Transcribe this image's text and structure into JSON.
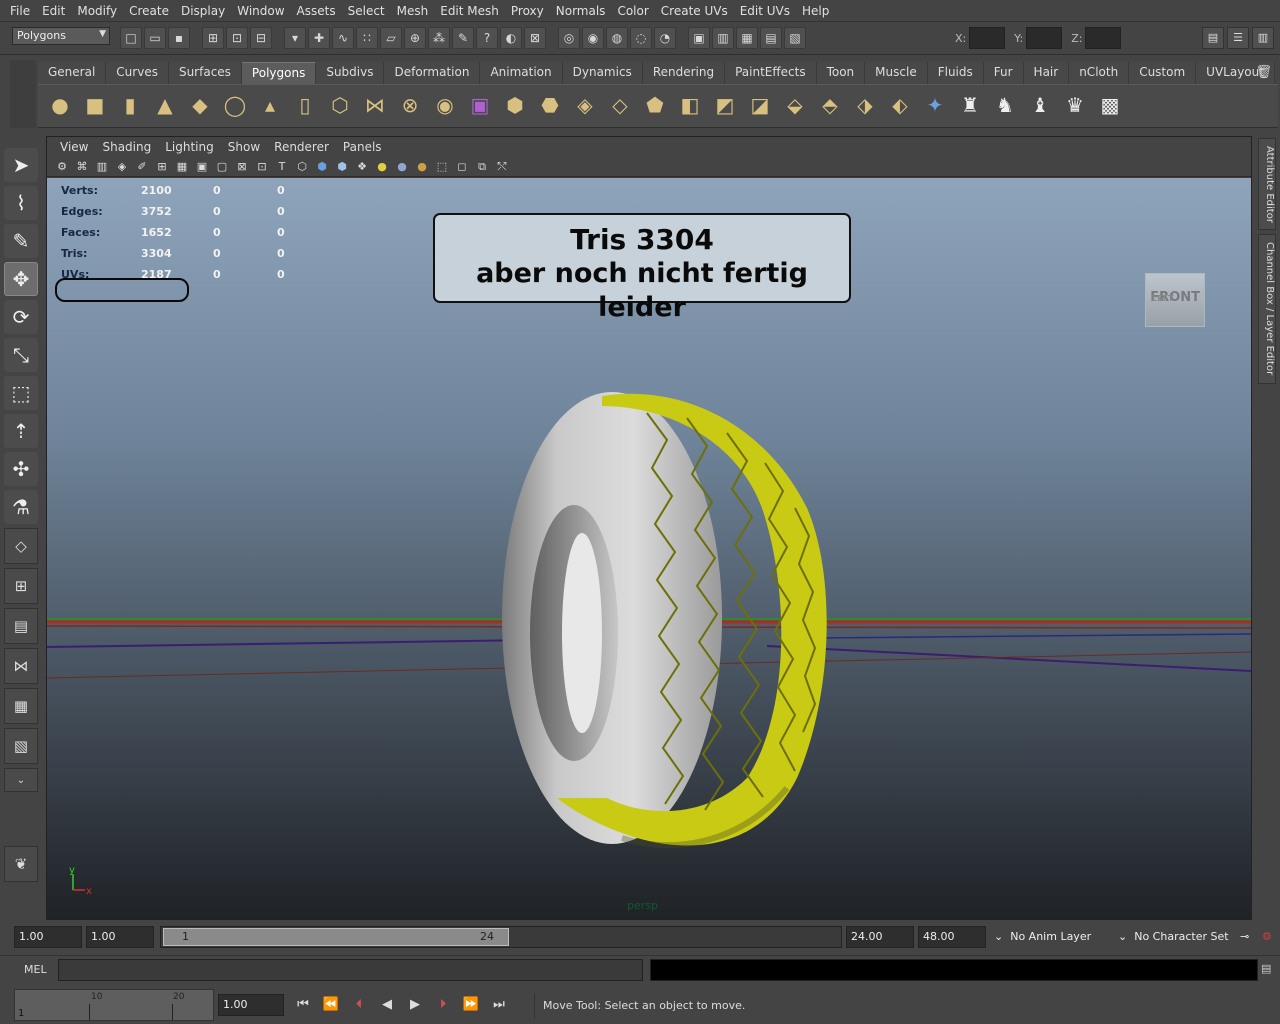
{
  "menus": [
    "File",
    "Edit",
    "Modify",
    "Create",
    "Display",
    "Window",
    "Assets",
    "Select",
    "Mesh",
    "Edit Mesh",
    "Proxy",
    "Normals",
    "Color",
    "Create UVs",
    "Edit UVs",
    "Help"
  ],
  "statusline": {
    "mode": "Polygons",
    "xyz_labels": [
      "X:",
      "Y:",
      "Z:"
    ]
  },
  "shelf_tabs": [
    "General",
    "Curves",
    "Surfaces",
    "Polygons",
    "Subdivs",
    "Deformation",
    "Animation",
    "Dynamics",
    "Rendering",
    "PaintEffects",
    "Toon",
    "Muscle",
    "Fluids",
    "Fur",
    "Hair",
    "nCloth",
    "Custom",
    "UVLayout"
  ],
  "active_shelf": "Polygons",
  "panel_menus": [
    "View",
    "Shading",
    "Lighting",
    "Show",
    "Renderer",
    "Panels"
  ],
  "hud": {
    "rows": [
      {
        "label": "Verts:",
        "v1": "2100",
        "v2": "0",
        "v3": "0"
      },
      {
        "label": "Edges:",
        "v1": "3752",
        "v2": "0",
        "v3": "0"
      },
      {
        "label": "Faces:",
        "v1": "1652",
        "v2": "0",
        "v3": "0"
      },
      {
        "label": "Tris:",
        "v1": "3304",
        "v2": "0",
        "v3": "0"
      },
      {
        "label": "UVs:",
        "v1": "2187",
        "v2": "0",
        "v3": "0"
      }
    ]
  },
  "callout": {
    "line1": "Tris 3304",
    "line2": "aber noch nicht fertig leider"
  },
  "viewcube_label": "FRONT",
  "viewcube_left": "LEFT",
  "camera_label": "persp",
  "axis": {
    "y": "y",
    "x": "x"
  },
  "side_tabs": [
    "Attribute Editor",
    "Channel Box / Layer Editor"
  ],
  "range": {
    "start": "1.00",
    "playback_start": "1.00",
    "slider_start": "1",
    "slider_end": "24",
    "playback_end": "24.00",
    "end": "48.00",
    "anim_layer": "No Anim Layer",
    "character_set": "No Character Set"
  },
  "mel_label": "MEL",
  "timeline": {
    "ticks": [
      "10",
      "20"
    ],
    "current_frame_mark": "1",
    "current_time": "1.00"
  },
  "help_line": "Move Tool: Select an object to move.",
  "colors": {
    "tread": "#d6d81a",
    "rubber": "#b8b8b8"
  }
}
